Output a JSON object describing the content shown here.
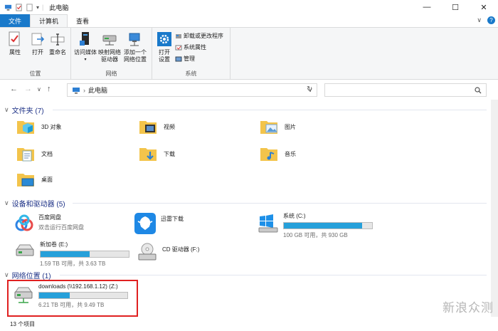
{
  "window": {
    "title": "此电脑",
    "minimize": "—",
    "maximize": "☐",
    "close": "✕",
    "quick_access_dropdown": "▾"
  },
  "tabs": [
    {
      "label": "文件"
    },
    {
      "label": "计算机"
    },
    {
      "label": "查看"
    }
  ],
  "ribbon": {
    "groups": [
      {
        "label": "位置",
        "buttons": [
          "属性",
          "打开",
          "重命名"
        ]
      },
      {
        "label": "网络",
        "buttons": [
          "访问媒体",
          "映射网络\n驱动器",
          "添加一个\n网络位置"
        ]
      },
      {
        "label": "系统",
        "big_button": "打开\n设置",
        "small_buttons": [
          "卸载或更改程序",
          "系统属性",
          "管理"
        ]
      }
    ],
    "collapse_chevron": "∨",
    "help": "?"
  },
  "nav": {
    "back": "←",
    "forward": "→",
    "dropdown": "∨",
    "up": "↑",
    "address": "此电脑",
    "address_sep": "›",
    "address_dropdown": "∨",
    "refresh": "↻",
    "search_placeholder": ""
  },
  "sections": {
    "folders": {
      "title": "文件夹 (7)",
      "items": [
        "3D 对象",
        "视频",
        "图片",
        "文档",
        "下载",
        "音乐",
        "桌面"
      ]
    },
    "devices": {
      "title": "设备和驱动器 (5)",
      "items": [
        {
          "name": "百度网盘",
          "sub": "双击运行百度网盘"
        },
        {
          "name": "迅雷下载",
          "sub": ""
        },
        {
          "name": "系统 (C:)",
          "sub": "100 GB 可用，共 930 GB",
          "used_fraction": 0.89
        },
        {
          "name": "新加卷 (E:)",
          "sub": "1.59 TB 可用，共 3.63 TB",
          "used_fraction": 0.56
        },
        {
          "name": "CD 驱动器 (F:)",
          "sub": ""
        }
      ]
    },
    "network": {
      "title": "网络位置 (1)",
      "items": [
        {
          "name": "downloads (\\\\192.168.1.12) (Z:)",
          "sub": "6.21 TB 可用，共 9.49 TB",
          "used_fraction": 0.35
        }
      ]
    }
  },
  "status": {
    "count": "13 个项目"
  },
  "watermark": "新浪众测",
  "colors": {
    "accent": "#1979ca",
    "bar_fill": "#26a0da",
    "highlight": "#e02020",
    "section_title": "#1e3287"
  }
}
